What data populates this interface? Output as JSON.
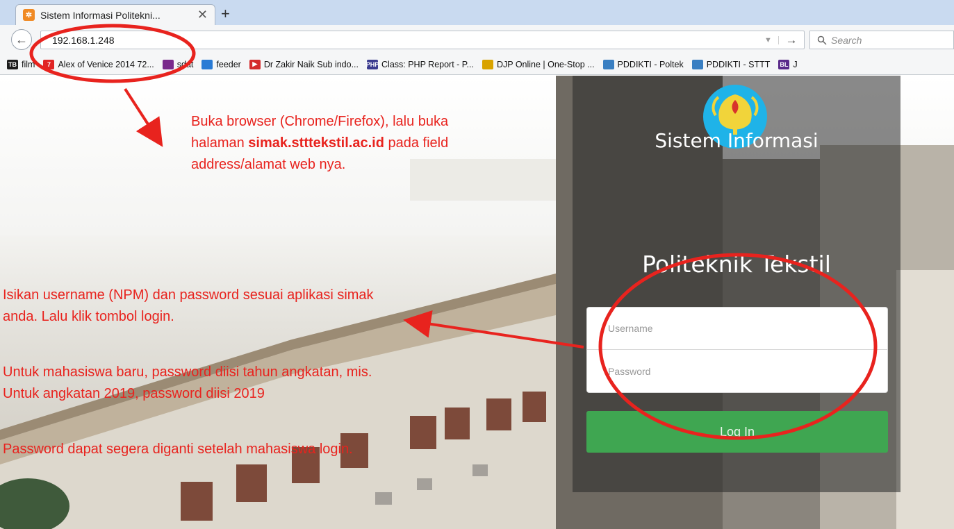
{
  "browser": {
    "tab_title": "Sistem Informasi Politekni...",
    "tab_close": "✕",
    "new_tab": "+",
    "back": "←",
    "url": "192.168.1.248",
    "url_dropdown": "▼",
    "url_go": "→",
    "search_placeholder": "Search"
  },
  "bookmarks": [
    {
      "icon_text": "TB",
      "label": "film",
      "color": "#1c1c1c"
    },
    {
      "icon_text": "7",
      "label": "Alex of Venice 2014 72...",
      "color": "#e02424"
    },
    {
      "icon_text": "",
      "label": "sdat",
      "color": "#7a2a8c"
    },
    {
      "icon_text": "",
      "label": "feeder",
      "color": "#2a7bd5"
    },
    {
      "icon_text": "▶",
      "label": "Dr Zakir Naik Sub indo...",
      "color": "#d42a2a"
    },
    {
      "icon_text": "PHP",
      "label": "Class: PHP Report - P...",
      "color": "#3b3b8f"
    },
    {
      "icon_text": "",
      "label": "DJP Online | One-Stop ...",
      "color": "#d9a300"
    },
    {
      "icon_text": "",
      "label": "PDDIKTI - Poltek",
      "color": "#3a7fc2"
    },
    {
      "icon_text": "",
      "label": "PDDIKTI - STTT",
      "color": "#3a7fc2"
    },
    {
      "icon_text": "BL",
      "label": "J",
      "color": "#5a2a8a"
    }
  ],
  "login": {
    "title_line1": "Sistem Informasi",
    "title_line2": "Politeknik Tekstil",
    "username_placeholder": "Username",
    "password_placeholder": "Password",
    "button_label": "Log In"
  },
  "annotations": {
    "note1_pre": "Buka browser (Chrome/Firefox), lalu buka halaman ",
    "note1_bold": "simak.stttekstil.ac.id",
    "note1_post": " pada field address/alamat web nya.",
    "note2": "Isikan username (NPM) dan password sesuai aplikasi simak anda. Lalu klik tombol login.",
    "note3": "Untuk mahasiswa baru, password diisi tahun angkatan, mis. Untuk angkatan 2019, password diisi 2019",
    "note4": "Password dapat segera diganti setelah mahasiswa login."
  },
  "colors": {
    "annotation": "#e8231e",
    "login_button": "#3fa651",
    "tab_bar": "#c9daf0"
  }
}
